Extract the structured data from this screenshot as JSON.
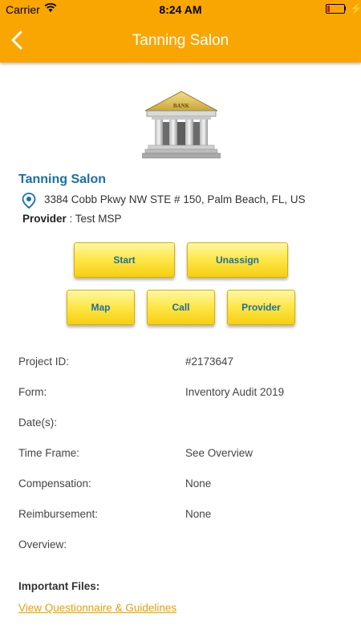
{
  "status_bar": {
    "carrier": "Carrier",
    "time": "8:24 AM"
  },
  "nav": {
    "title": "Tanning Salon",
    "back_icon": "chevron-left-icon"
  },
  "bank_image": {
    "text": "BANK"
  },
  "location": {
    "name": "Tanning Salon",
    "address": "3384 Cobb Pkwy NW STE # 150, Palm Beach, FL, US",
    "provider_label": "Provider",
    "provider_value": " : Test MSP"
  },
  "actions": {
    "start": "Start",
    "unassign": "Unassign",
    "map": "Map",
    "call": "Call",
    "provider": "Provider"
  },
  "details": [
    {
      "label": "Project ID:",
      "value": "#2173647"
    },
    {
      "label": "Form:",
      "value": "Inventory Audit 2019"
    },
    {
      "label": "Date(s):",
      "value": ""
    },
    {
      "label": "Time Frame:",
      "value": "See Overview"
    },
    {
      "label": "Compensation:",
      "value": "None"
    },
    {
      "label": "Reimbursement:",
      "value": "None"
    },
    {
      "label": "Overview:",
      "value": ""
    }
  ],
  "files": {
    "label": "Important Files:",
    "link": "View Questionnaire & Guidelines"
  },
  "colors": {
    "header": "#f9a602",
    "accent_blue": "#1a6fa8",
    "link": "#e5a100",
    "button": "#fde84c"
  }
}
